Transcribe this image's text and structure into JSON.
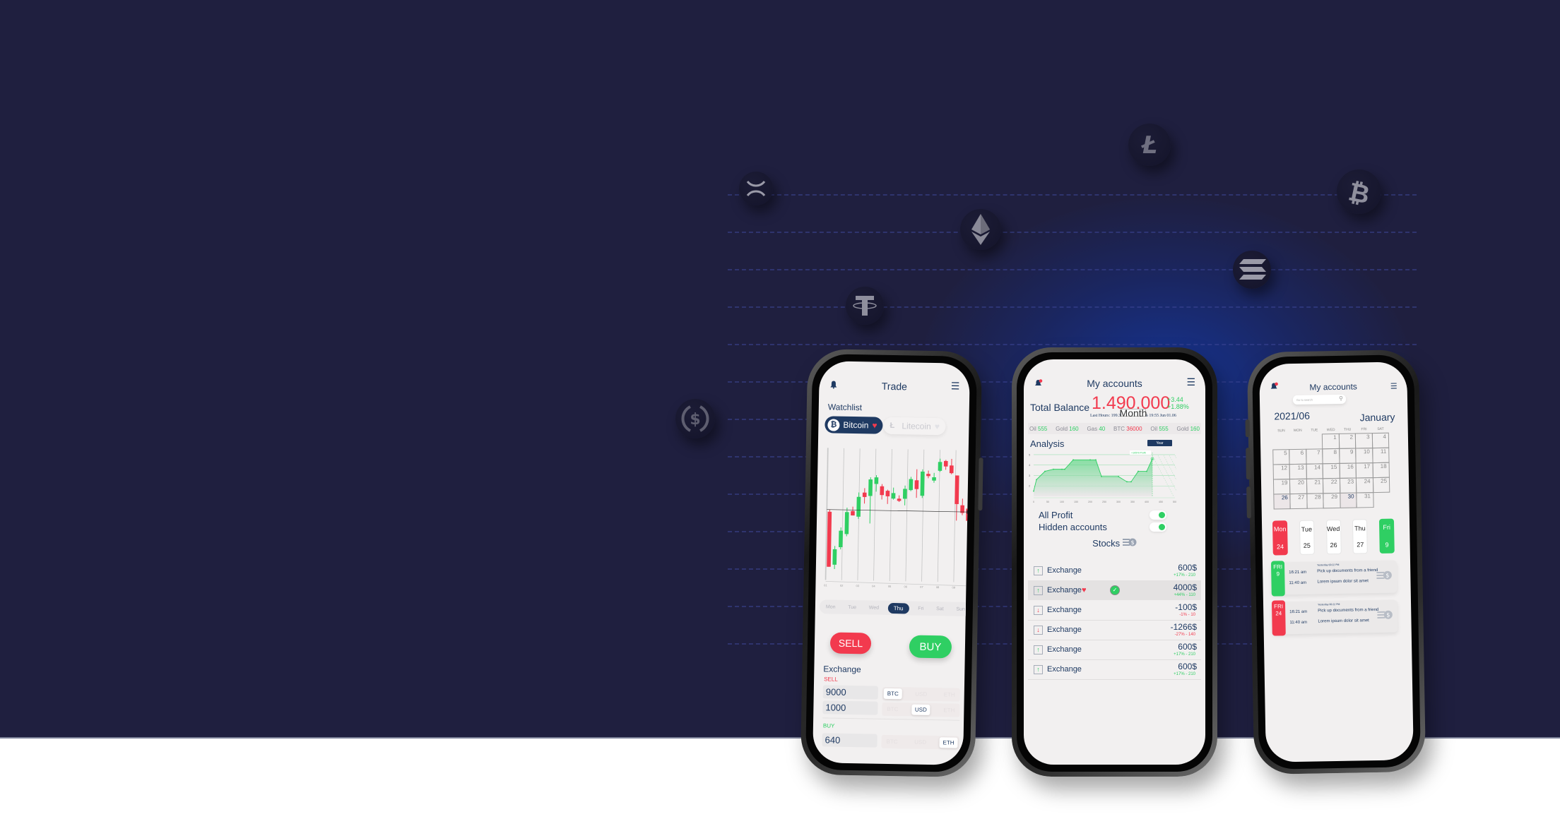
{
  "background": {
    "crypto_icons": [
      {
        "name": "xrp",
        "glyph": "X"
      },
      {
        "name": "ethereum",
        "glyph": "◆"
      },
      {
        "name": "tether",
        "glyph": "T"
      },
      {
        "name": "usd-coin",
        "glyph": "$"
      },
      {
        "name": "litecoin",
        "glyph": "Ł"
      },
      {
        "name": "bitcoin",
        "glyph": "₿"
      },
      {
        "name": "solana",
        "glyph": "≡"
      }
    ],
    "colors": {
      "hero": "#1f1f3f",
      "glow": "#1437a0",
      "page": "#ffffff"
    }
  },
  "phone_trade": {
    "title": "Trade",
    "watchlist_label": "Watchlist",
    "chips": [
      {
        "label": "Bitcoin",
        "symbol": "₿",
        "favorite": true,
        "active": true
      },
      {
        "label": "Litecoin",
        "symbol": "Ł",
        "favorite": false,
        "active": false
      }
    ],
    "chart_data": {
      "type": "candlestick",
      "x_ticks": [
        "01",
        "02",
        "03",
        "04",
        "05",
        "06",
        "07",
        "08",
        "09",
        "10"
      ],
      "candles": [
        {
          "o": 62,
          "c": 12,
          "h": 64,
          "l": 12
        },
        {
          "o": 14,
          "c": 28,
          "h": 31,
          "l": 10
        },
        {
          "o": 30,
          "c": 45,
          "h": 48,
          "l": 28
        },
        {
          "o": 42,
          "c": 62,
          "h": 66,
          "l": 40
        },
        {
          "o": 63,
          "c": 59,
          "h": 67,
          "l": 59
        },
        {
          "o": 58,
          "c": 76,
          "h": 80,
          "l": 56
        },
        {
          "o": 80,
          "c": 76,
          "h": 84,
          "l": 70
        },
        {
          "o": 77,
          "c": 92,
          "h": 94,
          "l": 52
        },
        {
          "o": 88,
          "c": 94,
          "h": 96,
          "l": 81
        },
        {
          "o": 86,
          "c": 78,
          "h": 88,
          "l": 74
        },
        {
          "o": 82,
          "c": 77,
          "h": 83,
          "l": 70
        },
        {
          "o": 75,
          "c": 80,
          "h": 85,
          "l": 74
        },
        {
          "o": 75,
          "c": 73,
          "h": 78,
          "l": 72
        },
        {
          "o": 75,
          "c": 84,
          "h": 87,
          "l": 69
        },
        {
          "o": 83,
          "c": 93,
          "h": 95,
          "l": 82
        },
        {
          "o": 92,
          "c": 84,
          "h": 102,
          "l": 76
        },
        {
          "o": 78,
          "c": 100,
          "h": 102,
          "l": 76
        },
        {
          "o": 98,
          "c": 96,
          "h": 101,
          "l": 94
        },
        {
          "o": 92,
          "c": 95,
          "h": 99,
          "l": 90
        },
        {
          "o": 101,
          "c": 109,
          "h": 112,
          "l": 100
        },
        {
          "o": 110,
          "c": 105,
          "h": 111,
          "l": 102
        },
        {
          "o": 106,
          "c": 99,
          "h": 112,
          "l": 98
        },
        {
          "o": 97,
          "c": 71,
          "h": 97,
          "l": 56
        },
        {
          "o": 70,
          "c": 63,
          "h": 76,
          "l": 61
        },
        {
          "o": 67,
          "c": 56,
          "h": 72,
          "l": 53
        }
      ],
      "price_line": 64,
      "ylim": [
        0,
        120
      ]
    },
    "days": [
      "Mon",
      "Tue",
      "Wed",
      "Thu",
      "Fri",
      "Sat",
      "Sun"
    ],
    "selected_day": "Thu",
    "sell_label": "SELL",
    "buy_label": "BUY",
    "exchange_title": "Exchange",
    "sell_section": "SELL",
    "buy_section": "BUY",
    "currencies": [
      "BTC",
      "USD",
      "ETH"
    ],
    "rows": [
      {
        "value": "9000",
        "selected": "BTC"
      },
      {
        "value": "1000",
        "selected": "USD"
      },
      {
        "value": "640",
        "selected": "ETH"
      }
    ]
  },
  "phone_accounts": {
    "title": "My accounts",
    "total_label": "Total Balance",
    "total_value": "1.490.000",
    "change_abs": "+3.44",
    "change_pct": "+1.88%",
    "last_hours": "Last Hours: 199.31 +0.31  +0.05%  19:55 Jun 01.06",
    "ticker": [
      {
        "name": "Oil",
        "value": "555",
        "trend": "up"
      },
      {
        "name": "Gold",
        "value": "160",
        "trend": "up"
      },
      {
        "name": "Gas",
        "value": "40",
        "trend": "up"
      },
      {
        "name": "BTC",
        "value": "36000",
        "trend": "down"
      },
      {
        "name": "Oil",
        "value": "555",
        "trend": "up"
      },
      {
        "name": "Gold",
        "value": "160",
        "trend": "up"
      }
    ],
    "analysis_title": "Analysis",
    "mode_month": "Month",
    "mode_year": "Year",
    "chart_data": {
      "type": "area",
      "x": [
        0,
        10,
        40,
        70,
        100,
        110,
        140,
        200,
        220,
        240,
        300,
        330,
        345,
        370,
        400,
        420
      ],
      "y": [
        1.5,
        2.6,
        3.4,
        3.6,
        3.6,
        3.6,
        4.5,
        4.5,
        4.5,
        2.9,
        2.9,
        2.4,
        2.4,
        3.4,
        3.4,
        4.6
      ],
      "x_ticks": [
        0,
        50,
        100,
        150,
        200,
        250,
        300,
        350,
        400,
        450,
        500
      ],
      "y_ticks": [
        2,
        3,
        4,
        5
      ],
      "xlim": [
        0,
        500
      ],
      "ylim": [
        1,
        5.2
      ],
      "annotation": "+105% Profit"
    },
    "all_profit_label": "All Profit",
    "all_profit_on": true,
    "hidden_accounts_label": "Hidden accounts",
    "hidden_accounts_on": true,
    "stocks_label": "Stocks",
    "transactions": [
      {
        "label": "Exchange",
        "dir": "up",
        "amount": "600$",
        "change": "+17% - 210",
        "favorite": false,
        "checked": false
      },
      {
        "label": "Exchange",
        "dir": "up",
        "amount": "4000$",
        "change": "+44% - 110",
        "favorite": true,
        "checked": true
      },
      {
        "label": "Exchange",
        "dir": "down",
        "amount": "-100$",
        "change": "-1% - 10",
        "favorite": false,
        "checked": false
      },
      {
        "label": "Exchange",
        "dir": "down",
        "amount": "-1266$",
        "change": "-27% - 140",
        "favorite": false,
        "checked": false
      },
      {
        "label": "Exchange",
        "dir": "up",
        "amount": "600$",
        "change": "+17% - 210",
        "favorite": false,
        "checked": false
      },
      {
        "label": "Exchange",
        "dir": "up",
        "amount": "600$",
        "change": "+17% - 210",
        "favorite": false,
        "checked": false
      }
    ]
  },
  "phone_calendar": {
    "title": "My accounts",
    "search_placeholder": "Go to search",
    "year_month": "2021/06",
    "month_name": "January",
    "dow": [
      "SUN",
      "MON",
      "TUE",
      "WED",
      "THU",
      "FRI",
      "SAT"
    ],
    "weeks": [
      [
        "",
        "",
        "",
        "1",
        "2",
        "3",
        "4"
      ],
      [
        "5",
        "6",
        "7",
        "8",
        "9",
        "10",
        "11"
      ],
      [
        "12",
        "13",
        "14",
        "15",
        "16",
        "17",
        "18"
      ],
      [
        "19",
        "20",
        "21",
        "22",
        "23",
        "24",
        "25"
      ],
      [
        "26",
        "27",
        "28",
        "29",
        "30",
        "31",
        ""
      ]
    ],
    "marked_days": [
      "26",
      "30"
    ],
    "week_strip": [
      {
        "day": "Mon",
        "date": "24",
        "style": "red"
      },
      {
        "day": "Tue",
        "date": "25",
        "style": "plain"
      },
      {
        "day": "Wed",
        "date": "26",
        "style": "plain"
      },
      {
        "day": "Thu",
        "date": "27",
        "style": "plain"
      },
      {
        "day": "Fri",
        "date": "9",
        "style": "green"
      }
    ],
    "events": [
      {
        "tag_day": "FRI",
        "tag_date": "9",
        "color": "green",
        "header": "Yesterday 00:22  PM",
        "items": [
          {
            "time": "16:21 am",
            "text": "Pick up documents from a friend"
          },
          {
            "time": "11:40 am",
            "text": "Lorem ipsum dolor sit amet"
          }
        ]
      },
      {
        "tag_day": "FRI",
        "tag_date": "24",
        "color": "red",
        "header": "Yesterday 00:22  PM",
        "items": [
          {
            "time": "16:21 am",
            "text": "Pick up documents from a friend"
          },
          {
            "time": "11:40 am",
            "text": "Lorem ipsum dolor sit amet"
          }
        ]
      }
    ]
  }
}
